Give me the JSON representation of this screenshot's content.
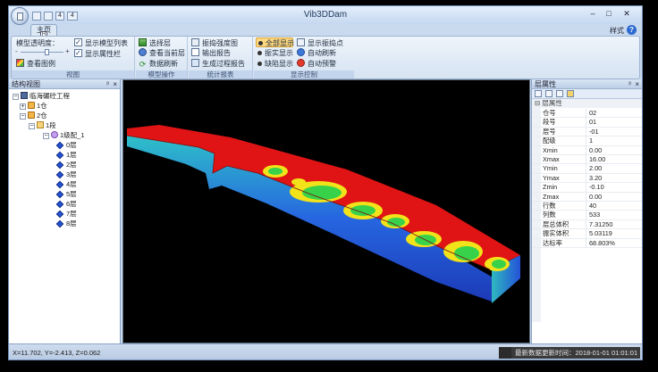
{
  "window": {
    "title": "Vib3DDam",
    "minimize_label": "–",
    "maximize_label": "□",
    "close_label": "✕",
    "quick_access": [
      "",
      "",
      "4"
    ]
  },
  "tabs": {
    "main_label": "主页",
    "main_keytip": "H",
    "style_label": "样式"
  },
  "ribbon": {
    "view": {
      "label": "视图",
      "transparency_label": "模型透明度：",
      "transparency_level": 0.6,
      "show_model_list": "显示模型列表",
      "show_property_bar": "显示属性栏",
      "view_legend": "查看图例"
    },
    "model_ops": {
      "label": "模型操作",
      "select_layer": "选择层",
      "view_current_layer": "查看当前层",
      "refresh_data": "数据刷新"
    },
    "stats": {
      "label": "统计报表",
      "amplitude_chart": "振捣强度图",
      "export_report": "输出报告",
      "gen_process_report": "生成过程报告"
    },
    "display": {
      "label": "显示控制",
      "show_all": "全部显示",
      "vibrated_show": "振实显示",
      "defect_show": "缺陷显示",
      "show_points": "显示振捣点",
      "auto_refresh": "自动刷新",
      "auto_warning": "自动预警"
    }
  },
  "left_panel": {
    "title": "结构视图",
    "tree": [
      {
        "label": "临海碾砼工程",
        "expander": "−",
        "icon": "root"
      },
      {
        "label": "1仓",
        "expander": "+",
        "icon": "grp"
      },
      {
        "label": "2仓",
        "expander": "−",
        "icon": "grp"
      },
      {
        "label": "1段",
        "expander": "−",
        "icon": "fold"
      },
      {
        "label": "1级配_1",
        "expander": "−",
        "icon": "cfg"
      },
      {
        "label": "0层",
        "icon": "layer"
      },
      {
        "label": "1层",
        "icon": "layer"
      },
      {
        "label": "2层",
        "icon": "layer"
      },
      {
        "label": "3层",
        "icon": "layer"
      },
      {
        "label": "4层",
        "icon": "layer"
      },
      {
        "label": "5层",
        "icon": "layer"
      },
      {
        "label": "6层",
        "icon": "layer"
      },
      {
        "label": "7层",
        "icon": "layer"
      },
      {
        "label": "8层",
        "icon": "layer"
      }
    ]
  },
  "right_panel": {
    "title": "层属性",
    "category": "层属性",
    "properties": [
      {
        "key": "仓号",
        "value": "02"
      },
      {
        "key": "段号",
        "value": "01"
      },
      {
        "key": "层号",
        "value": "-01"
      },
      {
        "key": "配级",
        "value": "1"
      },
      {
        "key": "Xmin",
        "value": "0.00"
      },
      {
        "key": "Xmax",
        "value": "16.00"
      },
      {
        "key": "Ymin",
        "value": "2.00"
      },
      {
        "key": "Ymax",
        "value": "3.20"
      },
      {
        "key": "Zmin",
        "value": "-0.10"
      },
      {
        "key": "Zmax",
        "value": "0.00"
      },
      {
        "key": "行数",
        "value": "40"
      },
      {
        "key": "列数",
        "value": "533"
      },
      {
        "key": "层总体积",
        "value": "7.31250"
      },
      {
        "key": "振实体积",
        "value": "5.03119"
      },
      {
        "key": "达标率",
        "value": "68.803%"
      }
    ]
  },
  "status": {
    "coords": "X=11.702, Y=-2.413, Z=0.062",
    "last_update": "最新数据更新时间：2018-01-01 01:01:01"
  },
  "colors": {
    "heat_high": "#e01414",
    "heat_mid": "#f2e21a",
    "heat_low": "#37d24a",
    "side_blue": "#1f5ad8",
    "ribbon_bg": "#d6e3f2"
  }
}
